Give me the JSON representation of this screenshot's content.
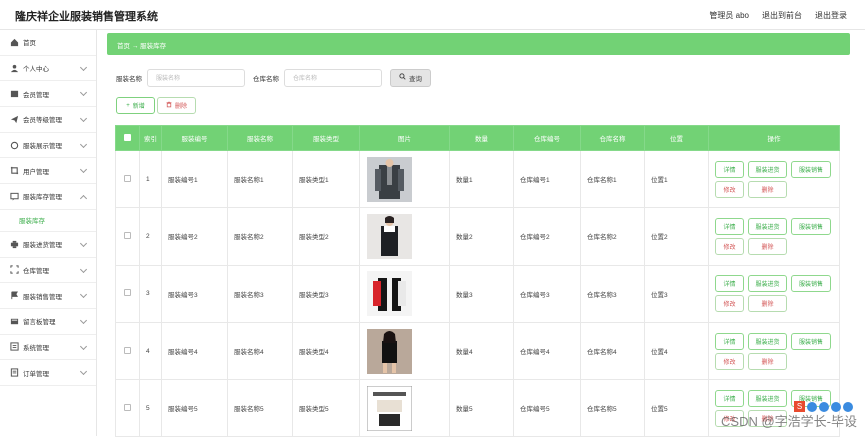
{
  "app": {
    "title": "隆庆祥企业服装销售管理系统"
  },
  "topnav": {
    "user": "管理员 abo",
    "frontend": "退出到前台",
    "logout": "退出登录"
  },
  "sidebar": {
    "items": [
      {
        "label": "首页",
        "icon": "home-icon",
        "has_chevron": false
      },
      {
        "label": "个人中心",
        "icon": "user-icon",
        "has_chevron": true
      },
      {
        "label": "会员管理",
        "icon": "folder-icon",
        "has_chevron": true
      },
      {
        "label": "会员等级管理",
        "icon": "send-icon",
        "has_chevron": true
      },
      {
        "label": "服装展示管理",
        "icon": "circle-icon",
        "has_chevron": true
      },
      {
        "label": "用户管理",
        "icon": "crop-icon",
        "has_chevron": true
      },
      {
        "label": "服装库存管理",
        "icon": "message-icon",
        "has_chevron": true,
        "open": true,
        "sub": "服装库存"
      },
      {
        "label": "服装进货管理",
        "icon": "print-icon",
        "has_chevron": true
      },
      {
        "label": "仓库管理",
        "icon": "expand-icon",
        "has_chevron": true
      },
      {
        "label": "服装销售管理",
        "icon": "flag-icon",
        "has_chevron": true
      },
      {
        "label": "留言板管理",
        "icon": "board-icon",
        "has_chevron": true
      },
      {
        "label": "系统管理",
        "icon": "system-icon",
        "has_chevron": true
      },
      {
        "label": "订单管理",
        "icon": "order-icon",
        "has_chevron": true
      }
    ]
  },
  "breadcrumb": {
    "home": "首页",
    "arrow": "→",
    "current": "服装库存"
  },
  "search": {
    "name_label": "服装名称",
    "name_placeholder": "服装名称",
    "warehouse_label": "仓库名称",
    "warehouse_placeholder": "仓库名称",
    "button": "查询"
  },
  "ops": {
    "add": "新增",
    "delete": "删除"
  },
  "table": {
    "headers": [
      "索引",
      "服装编号",
      "服装名称",
      "服装类型",
      "图片",
      "数量",
      "仓库编号",
      "仓库名称",
      "位置",
      "操作"
    ],
    "rows": [
      {
        "index": "1",
        "code": "服装编号1",
        "name": "服装名称1",
        "type": "服装类型1",
        "qty": "数量1",
        "wh_code": "仓库编号1",
        "wh_name": "仓库名称1",
        "pos": "位置1"
      },
      {
        "index": "2",
        "code": "服装编号2",
        "name": "服装名称2",
        "type": "服装类型2",
        "qty": "数量2",
        "wh_code": "仓库编号2",
        "wh_name": "仓库名称2",
        "pos": "位置2"
      },
      {
        "index": "3",
        "code": "服装编号3",
        "name": "服装名称3",
        "type": "服装类型3",
        "qty": "数量3",
        "wh_code": "仓库编号3",
        "wh_name": "仓库名称3",
        "pos": "位置3"
      },
      {
        "index": "4",
        "code": "服装编号4",
        "name": "服装名称4",
        "type": "服装类型4",
        "qty": "数量4",
        "wh_code": "仓库编号4",
        "wh_name": "仓库名称4",
        "pos": "位置4"
      },
      {
        "index": "5",
        "code": "服装编号5",
        "name": "服装名称5",
        "type": "服装类型5",
        "qty": "数量5",
        "wh_code": "仓库编号5",
        "wh_name": "仓库名称5",
        "pos": "位置5"
      }
    ],
    "actions": {
      "detail": "详情",
      "purchase": "服装进货",
      "sale": "服装销售",
      "edit": "修改",
      "delete": "删除"
    }
  },
  "watermark": "CSDN @字浩学长-毕设",
  "colors": {
    "accent": "#72d275",
    "accent_text": "#3cae4b",
    "danger": "#d25454"
  }
}
